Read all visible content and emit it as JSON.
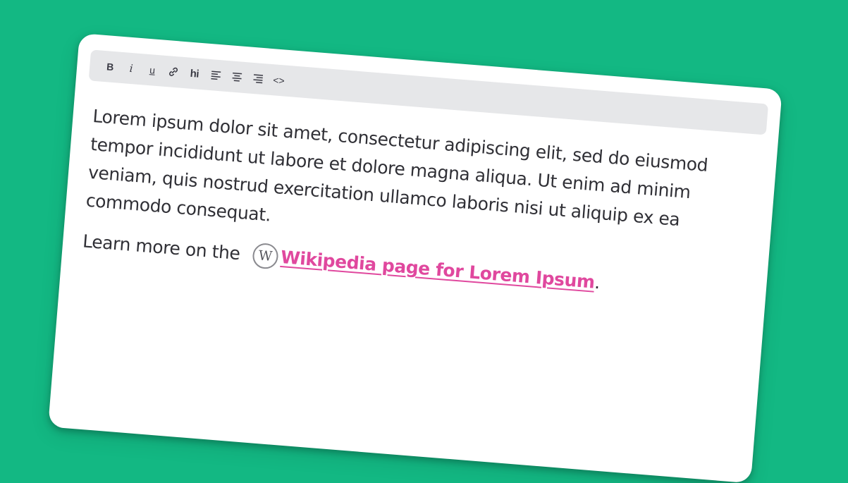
{
  "colors": {
    "background": "#13b883",
    "card": "#ffffff",
    "toolbar": "#e6e7e9",
    "text": "#303036",
    "link": "#e0489e"
  },
  "toolbar": {
    "bold_label": "B",
    "italic_label": "i",
    "underline_label": "u",
    "link_icon": "link-icon",
    "highlight_label": "hi",
    "align_left_icon": "align-left-icon",
    "align_center_icon": "align-center-icon",
    "align_right_icon": "align-right-icon",
    "code_label": "<>"
  },
  "content": {
    "paragraph": "Lorem ipsum dolor sit amet, consectetur adipiscing elit, sed do eiusmod tempor incididunt ut labore et dolore magna aliqua. Ut enim ad minim veniam, quis nostrud exercitation ullamco laboris nisi ut aliquip ex ea commodo consequat.",
    "learn_prefix": "Learn more on the",
    "wiki_badge": "W",
    "link_text": "Wikipedia page for Lorem Ipsum",
    "suffix": "."
  }
}
